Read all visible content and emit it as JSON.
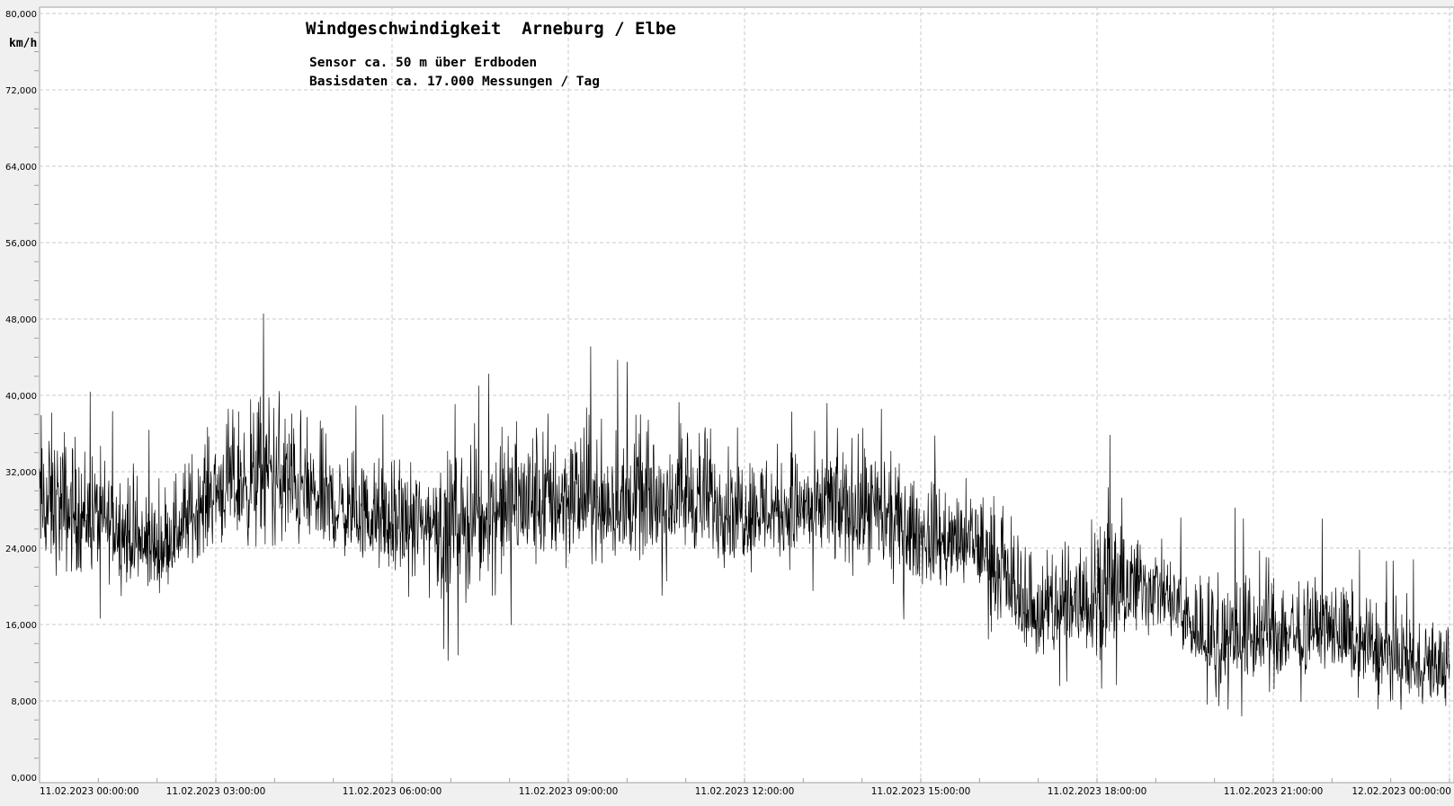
{
  "chart_data": {
    "type": "line",
    "title": "Windgeschwindigkeit  Arneburg / Elbe",
    "subtitle_lines": [
      "Sensor ca. 50 m über Erdboden",
      "Basisdaten ca. 17.000 Messungen / Tag"
    ],
    "ylabel": "km/h",
    "ylim": [
      0,
      80
    ],
    "y_ticks": [
      {
        "value": 0,
        "label": "0,000"
      },
      {
        "value": 8,
        "label": "8,000"
      },
      {
        "value": 16,
        "label": "16,000"
      },
      {
        "value": 24,
        "label": "24,000"
      },
      {
        "value": 32,
        "label": "32,000"
      },
      {
        "value": 40,
        "label": "40,000"
      },
      {
        "value": 48,
        "label": "48,000"
      },
      {
        "value": 56,
        "label": "56,000"
      },
      {
        "value": 64,
        "label": "64,000"
      },
      {
        "value": 72,
        "label": "72,000"
      },
      {
        "value": 80,
        "label": "80,000"
      }
    ],
    "xlim": [
      "11.02.2023 00:00:00",
      "12.02.2023 00:00:00"
    ],
    "x_ticks": [
      "11.02.2023  00:00:00",
      "11.02.2023  03:00:00",
      "11.02.2023  06:00:00",
      "11.02.2023  09:00:00",
      "11.02.2023  12:00:00",
      "11.02.2023  15:00:00",
      "11.02.2023  18:00:00",
      "11.02.2023  21:00:00",
      "12.02.2023  00:00:00"
    ],
    "grid": true,
    "series": [
      {
        "values_by_hour": [
          {
            "time": "00:00",
            "mean": 28,
            "min": 16,
            "max": 48
          },
          {
            "time": "01:00",
            "mean": 27,
            "min": 16,
            "max": 40
          },
          {
            "time": "02:00",
            "mean": 23,
            "min": 17,
            "max": 37
          },
          {
            "time": "03:00",
            "mean": 30,
            "min": 20,
            "max": 43
          },
          {
            "time": "04:00",
            "mean": 31,
            "min": 18,
            "max": 50
          },
          {
            "time": "05:00",
            "mean": 28,
            "min": 20,
            "max": 41
          },
          {
            "time": "06:00",
            "mean": 26,
            "min": 17,
            "max": 39
          },
          {
            "time": "07:00",
            "mean": 27,
            "min": 11,
            "max": 40
          },
          {
            "time": "08:00",
            "mean": 28,
            "min": 15,
            "max": 45
          },
          {
            "time": "09:00",
            "mean": 29,
            "min": 17,
            "max": 46
          },
          {
            "time": "10:00",
            "mean": 28,
            "min": 18,
            "max": 44
          },
          {
            "time": "11:00",
            "mean": 29,
            "min": 19,
            "max": 46
          },
          {
            "time": "12:00",
            "mean": 28,
            "min": 17,
            "max": 40
          },
          {
            "time": "13:00",
            "mean": 28,
            "min": 18,
            "max": 40
          },
          {
            "time": "14:00",
            "mean": 28,
            "min": 16,
            "max": 42
          },
          {
            "time": "15:00",
            "mean": 25,
            "min": 16,
            "max": 36
          },
          {
            "time": "16:00",
            "mean": 24,
            "min": 15,
            "max": 36
          },
          {
            "time": "17:00",
            "mean": 16,
            "min": 9,
            "max": 32
          },
          {
            "time": "18:00",
            "mean": 19,
            "min": 8,
            "max": 40
          },
          {
            "time": "19:00",
            "mean": 20,
            "min": 11,
            "max": 28
          },
          {
            "time": "20:00",
            "mean": 13,
            "min": 7,
            "max": 28
          },
          {
            "time": "21:00",
            "mean": 15,
            "min": 5,
            "max": 29
          },
          {
            "time": "22:00",
            "mean": 15,
            "min": 7,
            "max": 27
          },
          {
            "time": "23:00",
            "mean": 12,
            "min": 5,
            "max": 24
          },
          {
            "time": "24:00",
            "mean": 11,
            "min": 5,
            "max": 21
          }
        ]
      }
    ]
  },
  "colors": {
    "page_bg": "#f0f0f0",
    "plot_bg": "#ffffff",
    "grid": "#c8c8c8",
    "line": "#000000",
    "axis": "#a0a0a0",
    "text": "#000000"
  }
}
